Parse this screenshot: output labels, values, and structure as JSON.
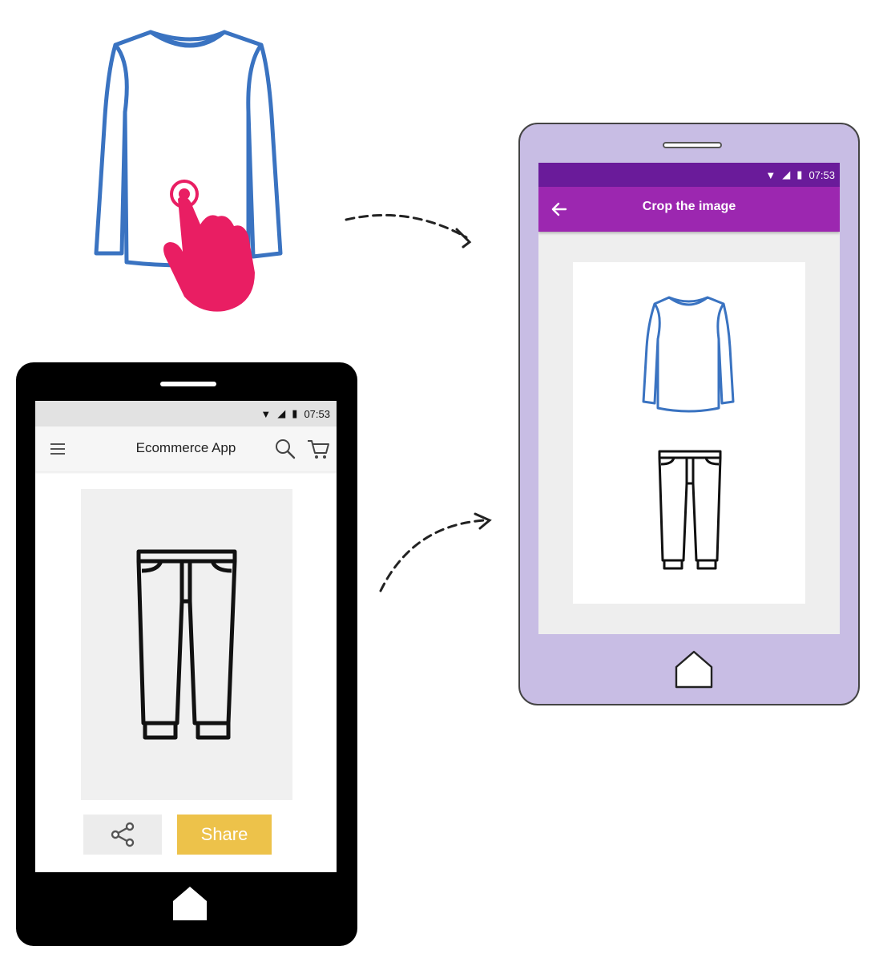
{
  "shirt_illustration": {
    "icon": "long-sleeve-shirt-icon",
    "color": "#3a73c1",
    "pointer_icon": "tap-hand-icon",
    "pointer_color": "#e91e63"
  },
  "arrows": [
    {
      "icon": "dashed-arrow-icon"
    },
    {
      "icon": "dashed-arrow-icon"
    }
  ],
  "left_phone": {
    "status_time": "07:53",
    "app_title": "Ecommerce App",
    "menu_icon": "hamburger-menu-icon",
    "search_icon": "search-icon",
    "cart_icon": "cart-icon",
    "product_icon": "pants-icon",
    "share_icon": "share-icon",
    "share_label": "Share",
    "share_color": "#edc24a",
    "home_icon": "home-icon"
  },
  "right_phone": {
    "status_time": "07:53",
    "screen_title": "Crop the image",
    "back_icon": "back-arrow-icon",
    "status_bar_color": "#6a1b9a",
    "app_bar_color": "#9c27b0",
    "body_color": "#c8bde4",
    "items": [
      {
        "icon": "long-sleeve-shirt-icon"
      },
      {
        "icon": "pants-icon"
      }
    ],
    "home_icon": "home-icon"
  }
}
